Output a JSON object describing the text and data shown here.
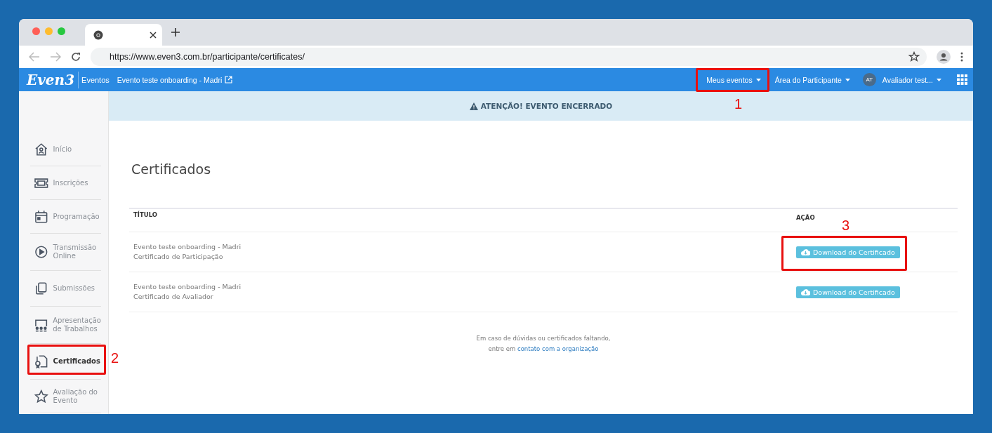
{
  "browser": {
    "url": "https://www.even3.com.br/participante/certificates/"
  },
  "navbar": {
    "logo": "Even3",
    "section": "Eventos",
    "event_link": "Evento teste onboarding - Madri",
    "menus": [
      {
        "label": "Meus eventos"
      },
      {
        "label": "Área do Participante"
      }
    ],
    "user": {
      "initials": "AT",
      "name": "Avaliador test..."
    }
  },
  "alert": "ATENÇÃO! EVENTO ENCERRADO",
  "sidebar": {
    "items": [
      {
        "label": "Início",
        "selected": false
      },
      {
        "label": "Inscrições",
        "selected": false
      },
      {
        "label": "Programação",
        "selected": false
      },
      {
        "label": "Transmissão Online",
        "selected": false
      },
      {
        "label": "Submissões",
        "selected": false
      },
      {
        "label": "Apresentação de Trabalhos",
        "selected": false
      },
      {
        "label": "Certificados",
        "selected": true
      },
      {
        "label": "Avaliação do Evento",
        "selected": false
      }
    ]
  },
  "page_title": "Certificados",
  "table": {
    "columns": [
      "TÍTULO",
      "AÇÃO"
    ],
    "rows": [
      {
        "event": "Evento teste onboarding - Madri",
        "certificate": "Certificado de Participação",
        "action": "Download do Certificado"
      },
      {
        "event": "Evento teste onboarding - Madri",
        "certificate": "Certificado de Avaliador",
        "action": "Download do Certificado"
      }
    ]
  },
  "footer_note": {
    "text": "Em caso de dúvidas ou certificados faltando,",
    "text2": "entre em",
    "link": "contato com a organização"
  },
  "annotations": [
    "1",
    "2",
    "3"
  ]
}
